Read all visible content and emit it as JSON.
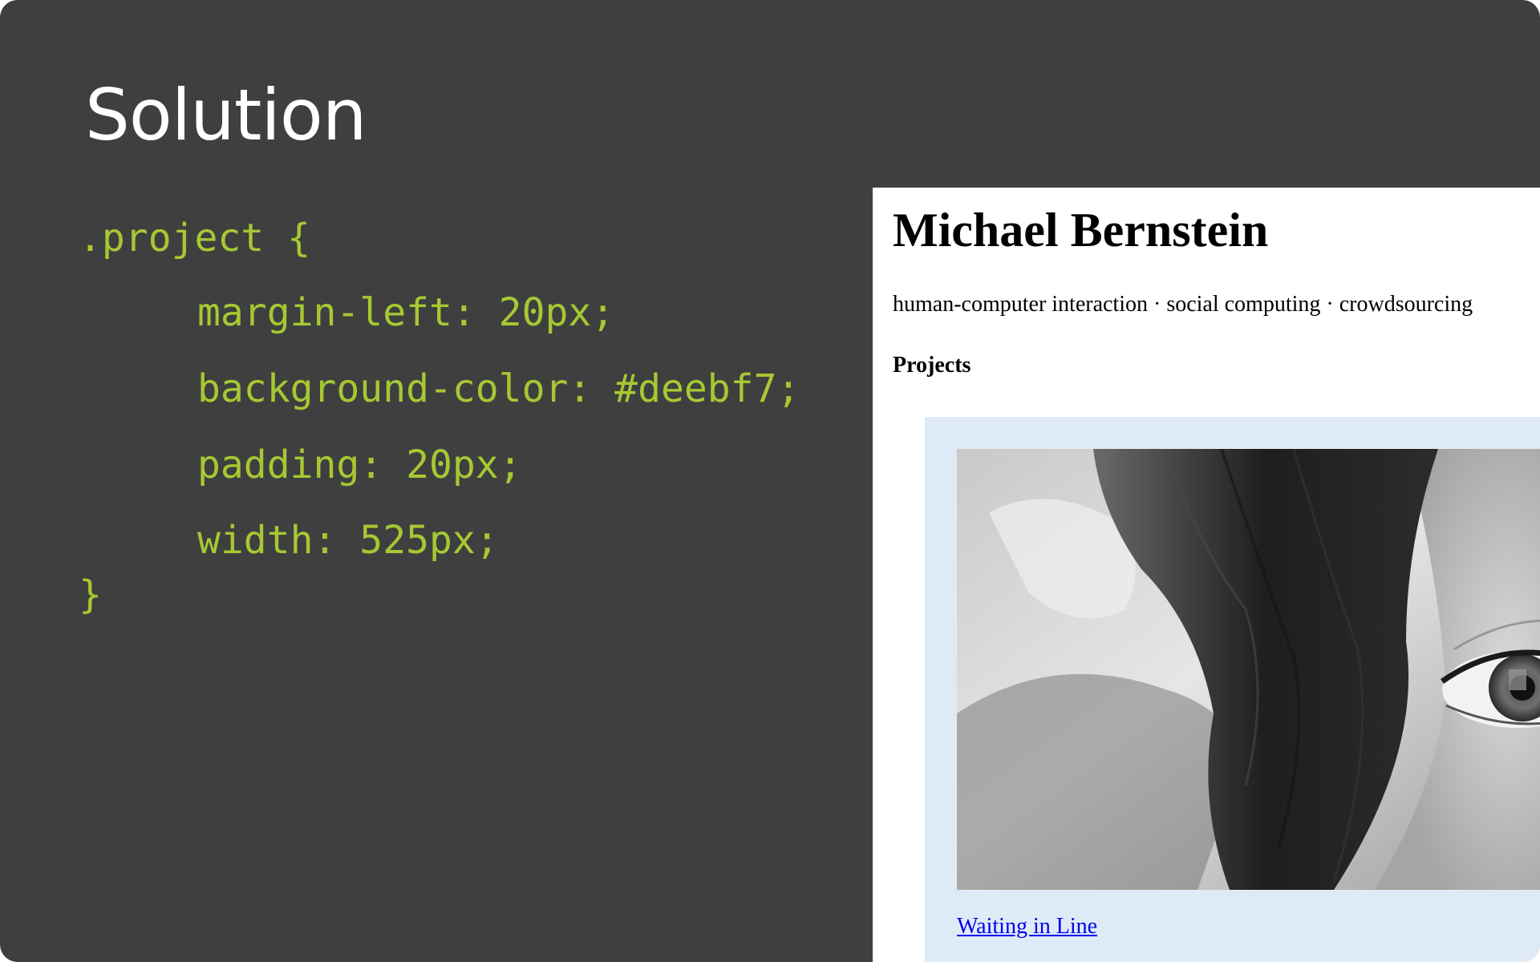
{
  "slide": {
    "title": "Solution",
    "background_color": "#3f3f3f",
    "code_color": "#a6c833",
    "code": {
      "selector_line": ".project {",
      "declarations": [
        "margin-left: 20px;",
        "background-color: #deebf7;",
        "padding: 20px;",
        "width: 525px;"
      ],
      "closing_brace": "}"
    }
  },
  "browser_preview": {
    "page_heading": "Michael Bernstein",
    "tagline": "human-computer interaction · social computing · crowdsourcing",
    "section_heading": "Projects",
    "project": {
      "background_color": "#deebf7",
      "image_description_icon": "photo-image",
      "link_text": "Waiting in Line",
      "link_color": "#0000ee"
    }
  }
}
